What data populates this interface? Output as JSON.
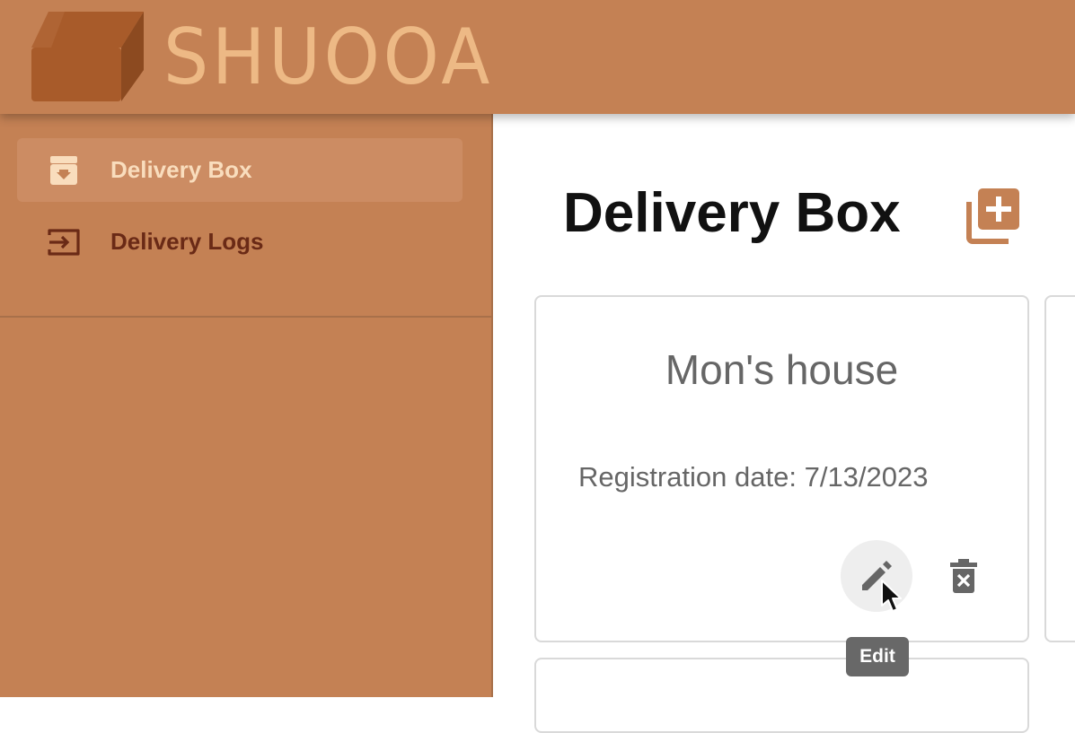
{
  "app": {
    "brand": "SHUOOA"
  },
  "sidebar": {
    "items": [
      {
        "label": "Delivery Box",
        "icon": "archive-download-icon",
        "active": true
      },
      {
        "label": "Delivery Logs",
        "icon": "login-arrow-icon",
        "active": false
      }
    ]
  },
  "main": {
    "title": "Delivery Box",
    "add_icon": "library-add-icon",
    "cards": [
      {
        "name": "Mon's house",
        "date": "Registration date: 7/13/2023"
      }
    ]
  },
  "tooltip": {
    "text": "Edit"
  },
  "colors": {
    "accent": "#c48154",
    "brand_text": "#edb985",
    "active_nav_bg": "#cc8c63",
    "active_nav_text": "#f9ddbd",
    "nav_text": "#6a2a16",
    "icon_dark": "#666666"
  }
}
